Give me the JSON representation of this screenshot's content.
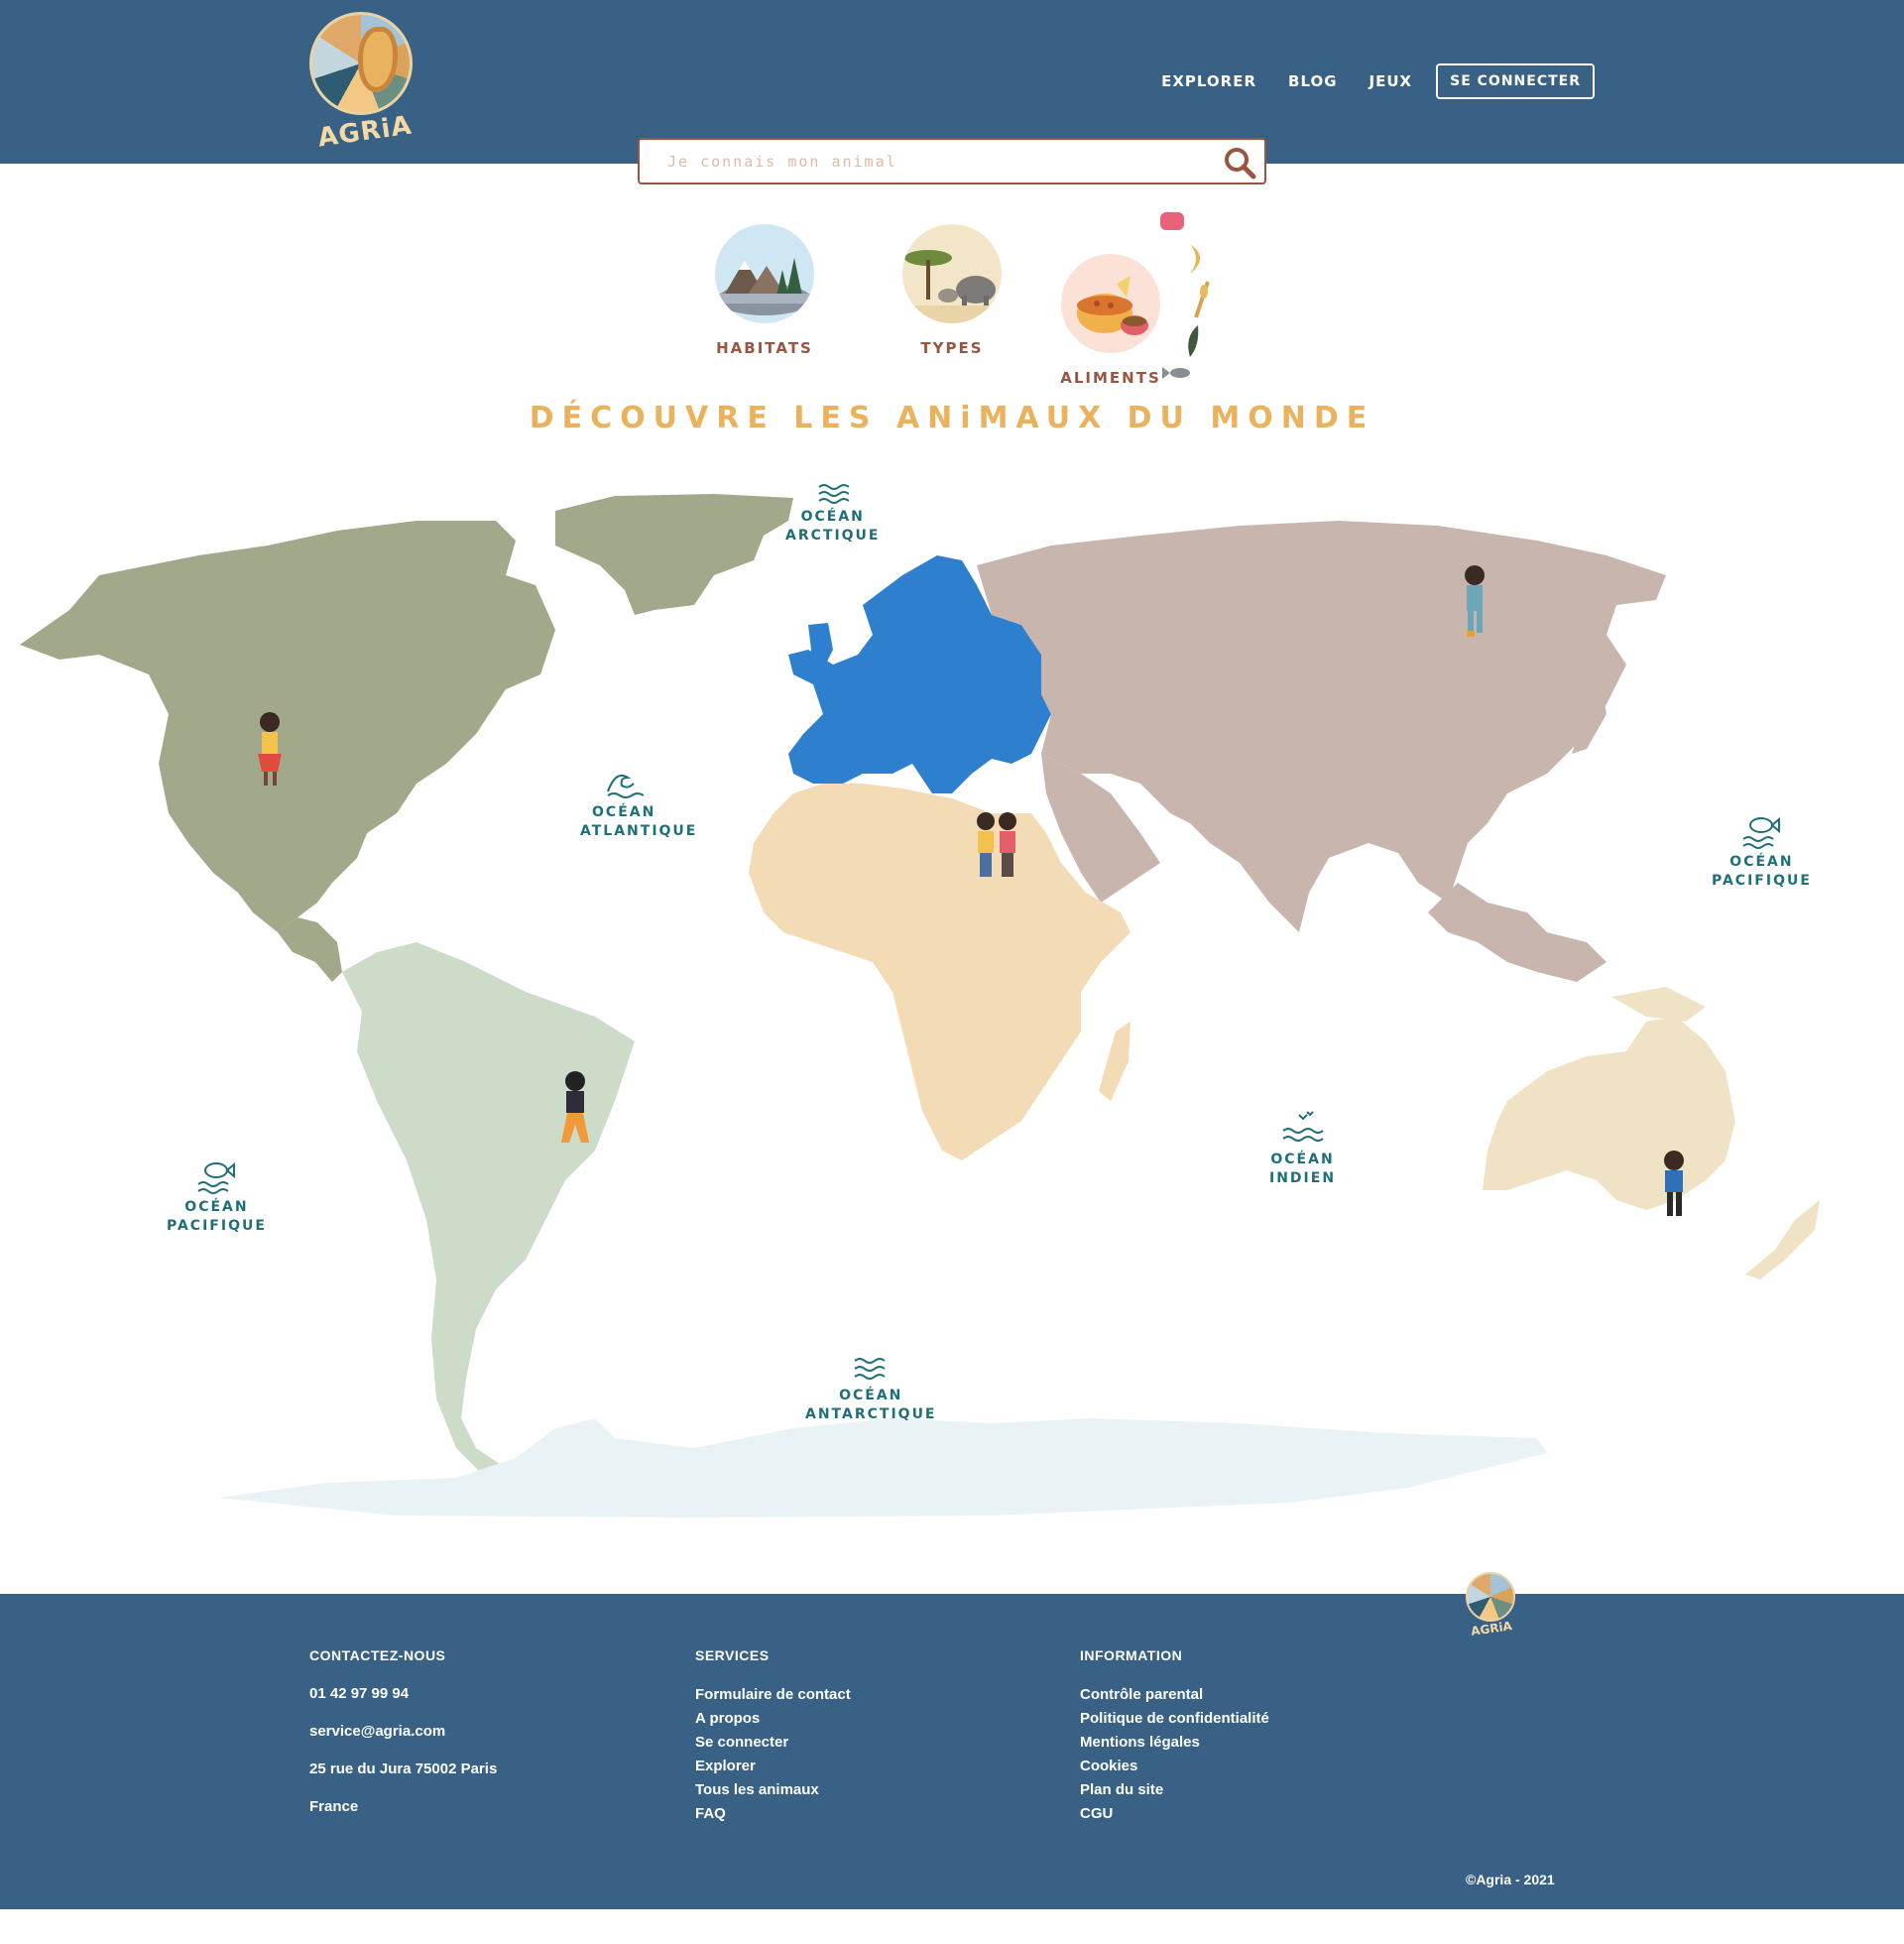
{
  "header": {
    "logo_text": "AGRiA",
    "nav": [
      "EXPLORER",
      "BLOG",
      "JEUX"
    ],
    "login_label": "SE CONNECTER"
  },
  "search": {
    "placeholder": "Je connais mon animal"
  },
  "categories": [
    {
      "label": "HABiTATS"
    },
    {
      "label": "TYPES"
    },
    {
      "label": "ALiMENTS"
    }
  ],
  "title": "DÉCOUVRE LES ANiMAUX DU MONDE",
  "map": {
    "oceans": [
      {
        "line1": "OCÉAN",
        "line2": "ARCTiQUE"
      },
      {
        "line1": "OCÉAN",
        "line2": "ATLANTiQUE"
      },
      {
        "line1": "OCÉAN",
        "line2": "PACiFiQUE"
      },
      {
        "line1": "OCÉAN",
        "line2": "PACiFiQUE"
      },
      {
        "line1": "OCÉAN",
        "line2": "iNDiEN"
      },
      {
        "line1": "OCÉAN",
        "line2": "ANTARCTiQUE"
      }
    ],
    "region_colors": {
      "north_america": "#a2a88a",
      "south_america": "#ccdcc9",
      "europe": "#2f7fcf",
      "asia": "#c8b5ad",
      "africa": "#f2dbb5",
      "oceania": "#f0e2c4",
      "antarctica": "#e9f2f5"
    }
  },
  "footer": {
    "contact": {
      "heading": "CONTACTEZ-NOUS",
      "items": [
        "01 42 97 99 94",
        "service@agria.com",
        "25 rue du Jura 75002 Paris",
        "France"
      ]
    },
    "services": {
      "heading": "SERVICES",
      "items": [
        "Formulaire de contact",
        "A propos",
        "Se connecter",
        "Explorer",
        "Tous les animaux",
        "FAQ"
      ]
    },
    "information": {
      "heading": "INFORMATION",
      "items": [
        "Contrôle parental",
        "Politique de confidentialité",
        "Mentions légales",
        "Cookies",
        "Plan du site",
        "CGU"
      ]
    },
    "logo_text": "AGRiA",
    "copyright": "©Agria - 2021"
  }
}
